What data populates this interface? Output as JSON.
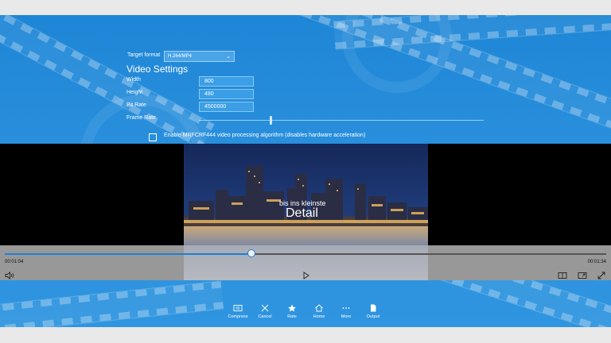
{
  "settings": {
    "target_format_label": "Target format",
    "target_format_value": "H.264/MP4",
    "video_settings_heading": "Video Settings",
    "width_label": "Width",
    "width_value": "800",
    "height_label": "Height",
    "height_value": "480",
    "bitrate_label": "Bit Rate",
    "bitrate_value": "4500000",
    "framerate_label": "Frame Rate",
    "framerate_level": 0.25,
    "mrf_checkbox_label": "Enable MRFCRF444 video processing algorithm (disables hardware acceleration)",
    "mrf_checked": false
  },
  "player": {
    "video_caption_line1": "bis ins kleinste",
    "video_caption_line2": "Detail",
    "current_time": "00:01:04",
    "total_time": "00:01:34",
    "progress": 0.41
  },
  "appbar": {
    "compress": "Compress",
    "cancel": "Cancel",
    "rate": "Rate",
    "home": "Home",
    "more": "More",
    "output": "Output"
  },
  "colors": {
    "accent": "#1e7fd4",
    "background": "#2a90dd"
  }
}
